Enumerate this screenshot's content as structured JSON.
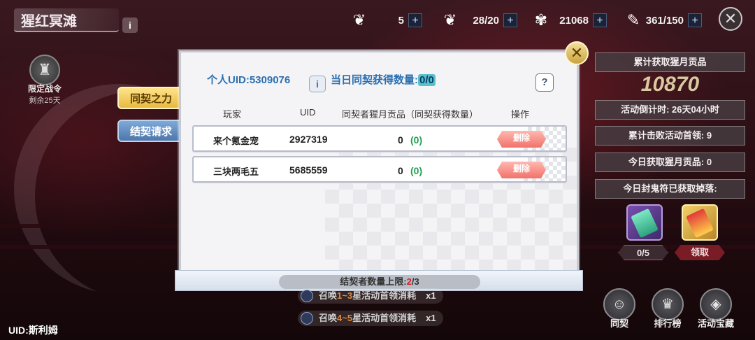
{
  "header": {
    "title": "猩红冥滩",
    "info_icon": "i",
    "resources": [
      {
        "icon": "ticket-icon",
        "value": "5",
        "plus": "+"
      },
      {
        "icon": "ticket-icon",
        "value": "28/20",
        "plus": "+"
      },
      {
        "icon": "coral-icon",
        "value": "21068",
        "plus": "+"
      },
      {
        "icon": "feather-icon",
        "value": "361/150",
        "plus": "+"
      }
    ],
    "close": "✕"
  },
  "battlepass": {
    "icon": "battlepass-icon",
    "title": "限定战令",
    "remaining": "剩余25天"
  },
  "side_tabs": {
    "bond_power": "同契之力",
    "bond_request": "结契请求"
  },
  "panel": {
    "uid_label": "个人UID:5309076",
    "info_btn": "i",
    "daily_label": "当日同契获得数量:",
    "daily_count": "0/0",
    "help_btn": "?",
    "close": "✕",
    "columns": {
      "player": "玩家",
      "uid": "UID",
      "tribute": "同契者猩月贡品（同契获得数量）",
      "action": "操作"
    },
    "rows": [
      {
        "name": "来个氪金宠",
        "uid": "2927319",
        "tribute": "0",
        "bonus": "(0)",
        "action": "删除"
      },
      {
        "name": "三块两毛五",
        "uid": "5685559",
        "tribute": "0",
        "bonus": "(0)",
        "action": "删除"
      }
    ],
    "limit_prefix": "结契者数量上限:",
    "limit_current": "2",
    "limit_total": "/3"
  },
  "stats": {
    "total_label": "累计获取猩月贡品",
    "total_value": "10870",
    "countdown": "活动倒计时: 26天04小时",
    "boss_kills": "累计击败活动首领: 9",
    "today_tribute": "今日获取猩月贡品: 0",
    "today_drop": "今日封鬼符已获取掉落:",
    "item_count": "0/5",
    "claim": "领取"
  },
  "bottom": {
    "cost1_prefix": "召唤",
    "cost1_range": "1~3",
    "cost1_suffix": "星活动首领消耗",
    "cost1_qty": "x1",
    "cost2_prefix": "召唤",
    "cost2_range": "4~5",
    "cost2_suffix": "星活动首领消耗",
    "cost2_qty": "x1",
    "uid": "UID:斯利姆",
    "nav": {
      "bond": "同契",
      "ranking": "排行榜",
      "treasure": "活动宝藏"
    }
  }
}
